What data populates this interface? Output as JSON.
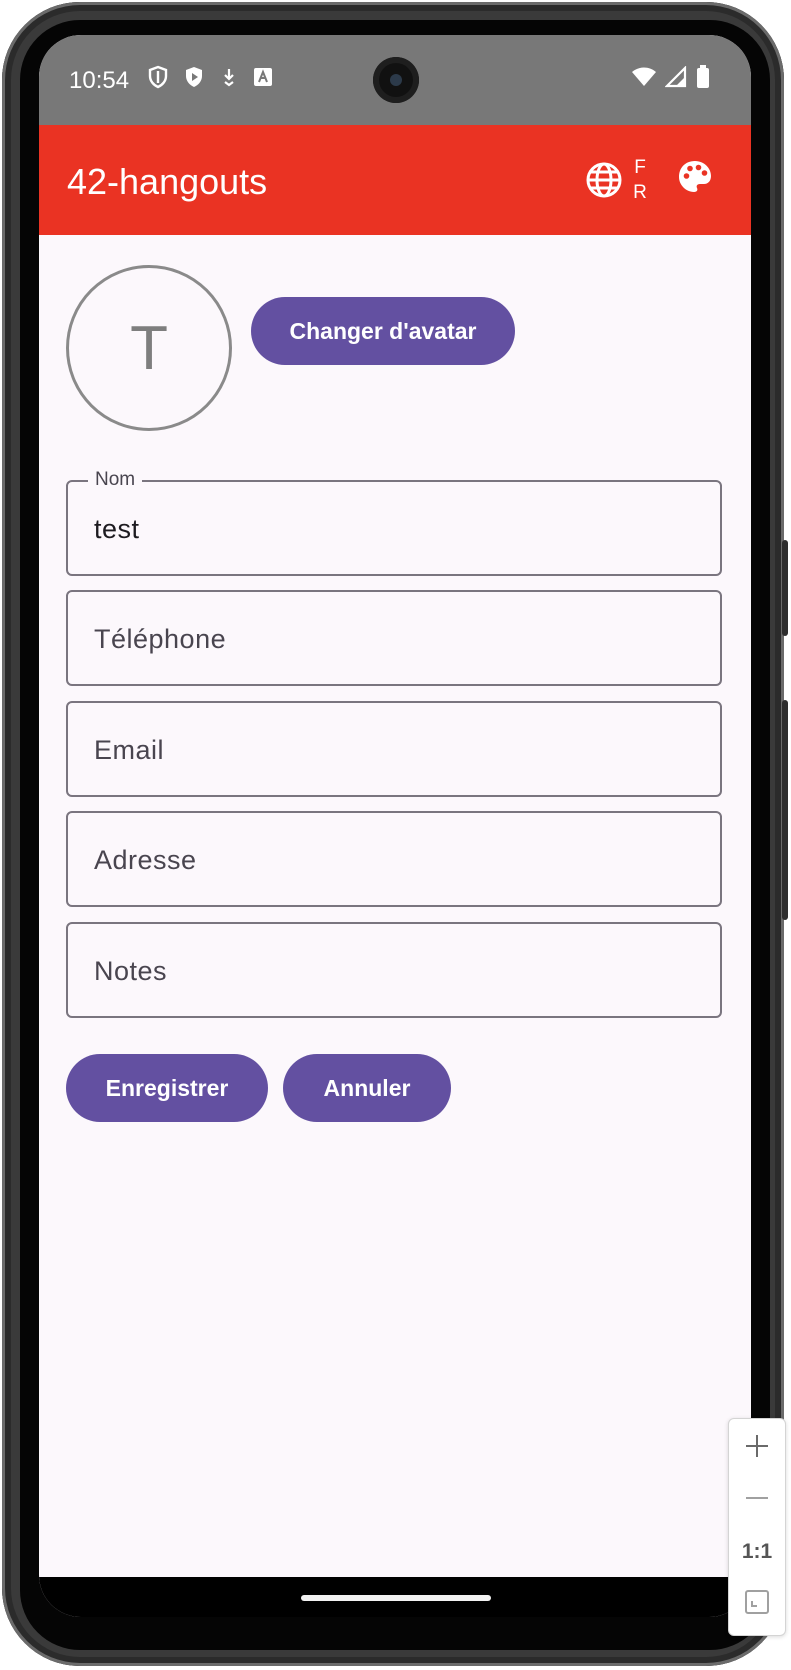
{
  "status_bar": {
    "time": "10:54",
    "left_icons": [
      "shield-outline-icon",
      "shield-play-icon",
      "download-icon",
      "a-badge-icon"
    ],
    "right_icons": [
      "wifi-icon",
      "cell-signal-icon",
      "battery-icon"
    ]
  },
  "app_bar": {
    "title": "42-hangouts",
    "language_code": "FR",
    "language_icon": "globe-icon",
    "theme_icon": "palette-icon",
    "color": "#ea3323"
  },
  "avatar": {
    "initial": "T",
    "change_button_label": "Changer d'avatar"
  },
  "form": {
    "fields": [
      {
        "label": "Nom",
        "value": "test",
        "placeholder": ""
      },
      {
        "label": "",
        "value": "",
        "placeholder": "Téléphone"
      },
      {
        "label": "",
        "value": "",
        "placeholder": "Email"
      },
      {
        "label": "",
        "value": "",
        "placeholder": "Adresse"
      },
      {
        "label": "",
        "value": "",
        "placeholder": "Notes"
      }
    ],
    "save_label": "Enregistrer",
    "cancel_label": "Annuler",
    "button_color": "#6350a1"
  },
  "emulator_zoom": {
    "zoom_in_icon": "plus-icon",
    "zoom_out_icon": "minus-icon",
    "actual_size_label": "1:1",
    "fit_icon": "fit-screen-icon"
  }
}
